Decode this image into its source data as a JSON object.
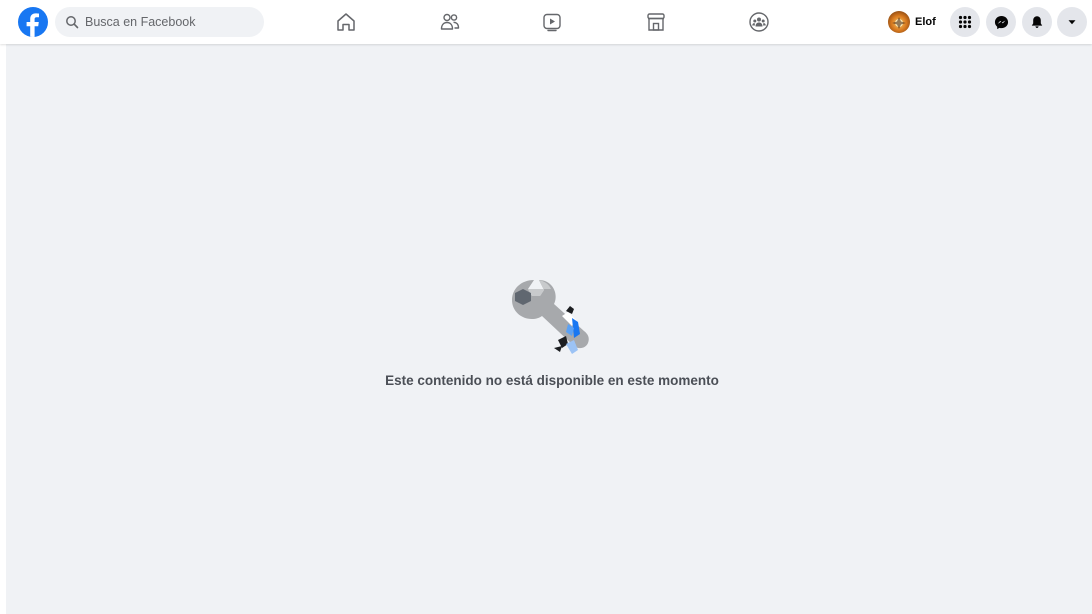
{
  "search": {
    "placeholder": "Busca en Facebook"
  },
  "nav": {
    "tabs": [
      {
        "id": "home",
        "icon": "home-icon"
      },
      {
        "id": "friends",
        "icon": "friends-icon"
      },
      {
        "id": "watch",
        "icon": "video-play-icon"
      },
      {
        "id": "marketplace",
        "icon": "marketplace-store-icon"
      },
      {
        "id": "groups",
        "icon": "groups-icon"
      }
    ]
  },
  "profile": {
    "name": "Elof"
  },
  "actions": {
    "menu_icon": "grid-menu-icon",
    "messenger_icon": "messenger-icon",
    "notifications_icon": "bell-icon",
    "account_icon": "caret-down-icon"
  },
  "content": {
    "message": "Este contenido no está disponible en este momento",
    "illustration_icon": "broken-wrench-icon"
  },
  "colors": {
    "brand": "#1877f2",
    "background": "#f0f2f5",
    "button": "#e4e6eb",
    "text": "#4b4f56"
  }
}
